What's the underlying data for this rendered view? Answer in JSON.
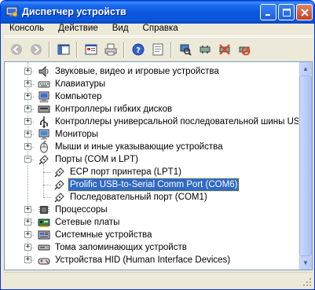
{
  "window": {
    "title": "Диспетчер устройств"
  },
  "menu": [
    "Консоль",
    "Действие",
    "Вид",
    "Справка"
  ],
  "toolbar": {
    "buttons": [
      {
        "name": "back-icon"
      },
      {
        "name": "forward-icon"
      },
      {
        "name": "console-tree-icon"
      },
      {
        "name": "properties-icon"
      },
      {
        "name": "print-icon"
      },
      {
        "name": "help-icon"
      },
      {
        "name": "view-icon"
      },
      {
        "name": "scan-hardware-icon"
      },
      {
        "name": "update-driver-icon"
      },
      {
        "name": "uninstall-icon"
      },
      {
        "name": "disable-icon"
      }
    ]
  },
  "tree": {
    "items": [
      {
        "label": "Звуковые, видео и игровые устройства",
        "icon": "sound-icon",
        "expanded": false
      },
      {
        "label": "Клавиатуры",
        "icon": "keyboard-icon",
        "expanded": false
      },
      {
        "label": "Компьютер",
        "icon": "computer-icon",
        "expanded": false
      },
      {
        "label": "Контроллеры гибких дисков",
        "icon": "floppy-controller-icon",
        "expanded": false
      },
      {
        "label": "Контроллеры универсальной последовательной шины USB",
        "icon": "usb-icon",
        "expanded": false
      },
      {
        "label": "Мониторы",
        "icon": "monitor-icon",
        "expanded": false
      },
      {
        "label": "Мыши и иные указывающие устройства",
        "icon": "mouse-icon",
        "expanded": false
      },
      {
        "label": "Порты (COM и LPT)",
        "icon": "port-icon",
        "expanded": true,
        "children": [
          {
            "label": "ECP порт принтера (LPT1)",
            "icon": "port-icon",
            "selected": false
          },
          {
            "label": "Prolific USB-to-Serial Comm Port (COM6)",
            "icon": "port-icon",
            "selected": true
          },
          {
            "label": "Последовательный порт (COM1)",
            "icon": "port-icon",
            "selected": false
          }
        ]
      },
      {
        "label": "Процессоры",
        "icon": "processor-icon",
        "expanded": false
      },
      {
        "label": "Сетевые платы",
        "icon": "network-card-icon",
        "expanded": false
      },
      {
        "label": "Системные устройства",
        "icon": "system-device-icon",
        "expanded": false
      },
      {
        "label": "Тома запоминающих устройств",
        "icon": "storage-volume-icon",
        "expanded": false
      },
      {
        "label": "Устройства HID (Human Interface Devices)",
        "icon": "hid-icon",
        "expanded": false
      }
    ]
  },
  "expander": {
    "plus": "+",
    "minus": "−"
  },
  "colors": {
    "selection": "#316ac5",
    "titlebar": "#0a5ee6",
    "chrome": "#ece9d8"
  }
}
